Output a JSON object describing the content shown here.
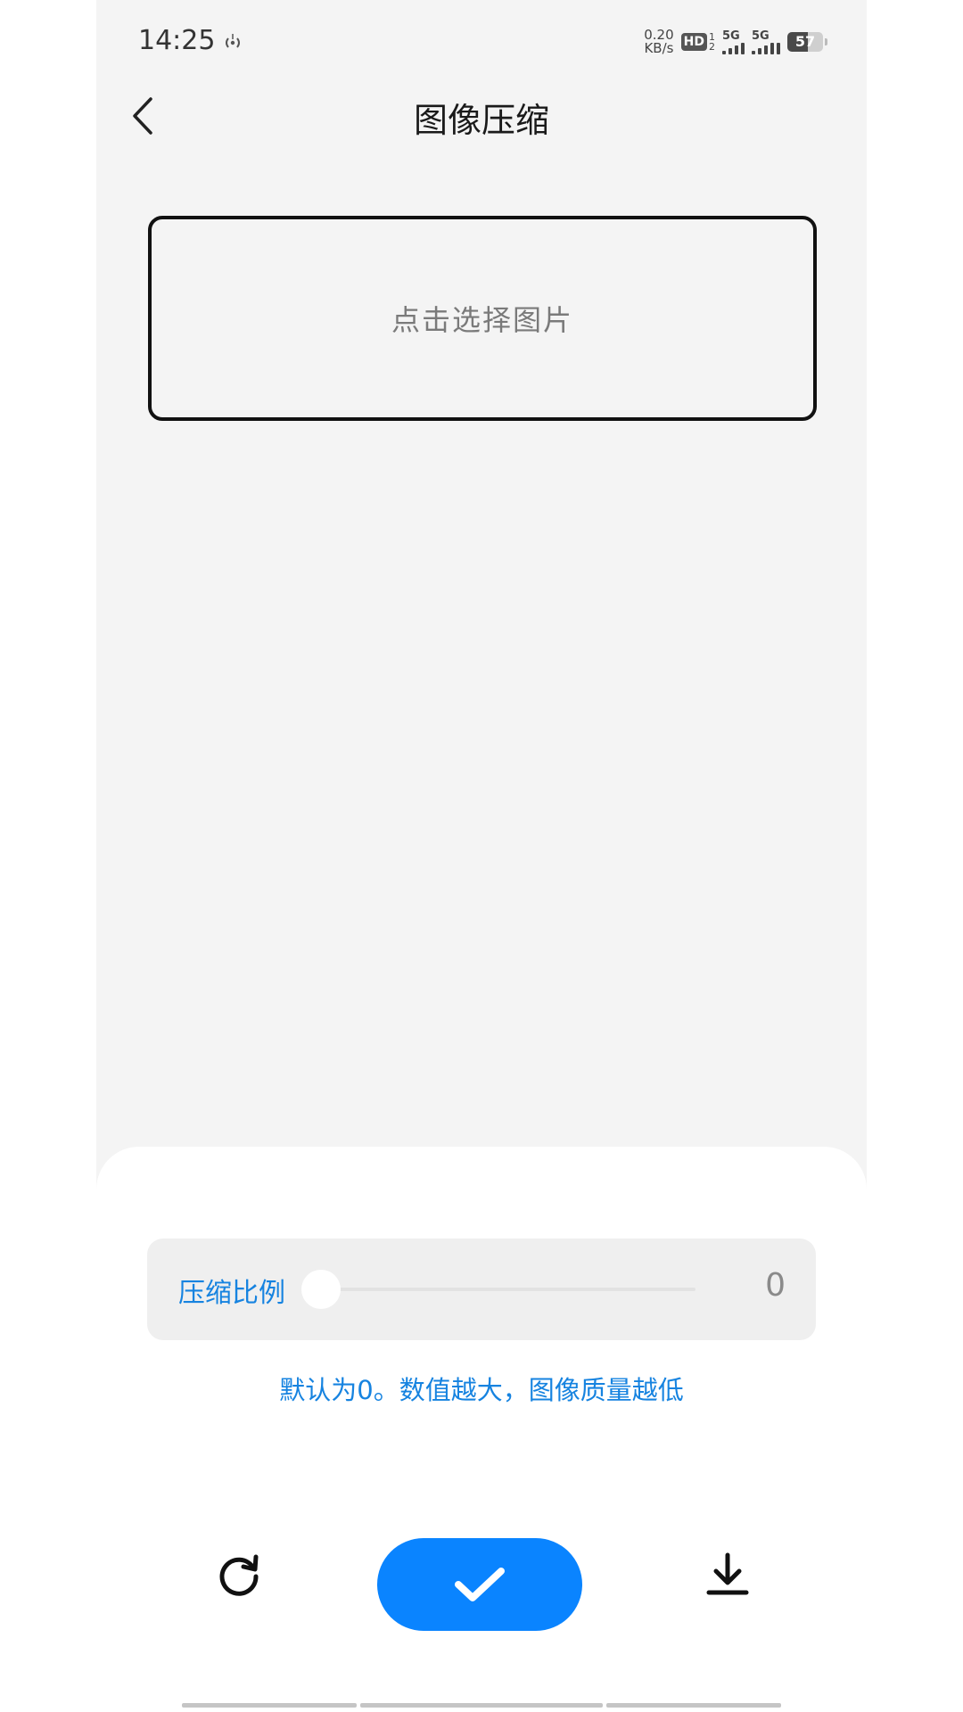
{
  "status_bar": {
    "time": "14:25",
    "net_speed_value": "0.20",
    "net_speed_unit": "KB/s",
    "hd_label": "HD",
    "hd_sim_top": "1",
    "hd_sim_bottom": "2",
    "signal1_label": "5G",
    "signal2_label": "5G",
    "battery_level": "57",
    "icons": [
      "hotspot-icon",
      "signal-icon",
      "battery-icon"
    ]
  },
  "header": {
    "title": "图像压缩",
    "back_icon": "chevron-left-icon"
  },
  "select_image": {
    "label": "点击选择图片"
  },
  "compression": {
    "label": "压缩比例",
    "value": "0",
    "min": 0,
    "max": 100,
    "hint": "默认为0。数值越大，图像质量越低"
  },
  "actions": {
    "reset_icon": "refresh-icon",
    "confirm_icon": "check-icon",
    "download_icon": "download-icon"
  },
  "colors": {
    "accent": "#0a84ff",
    "label_blue": "#1683e0",
    "page_bg": "#f4f4f4",
    "sheet_bg": "#ffffff"
  }
}
